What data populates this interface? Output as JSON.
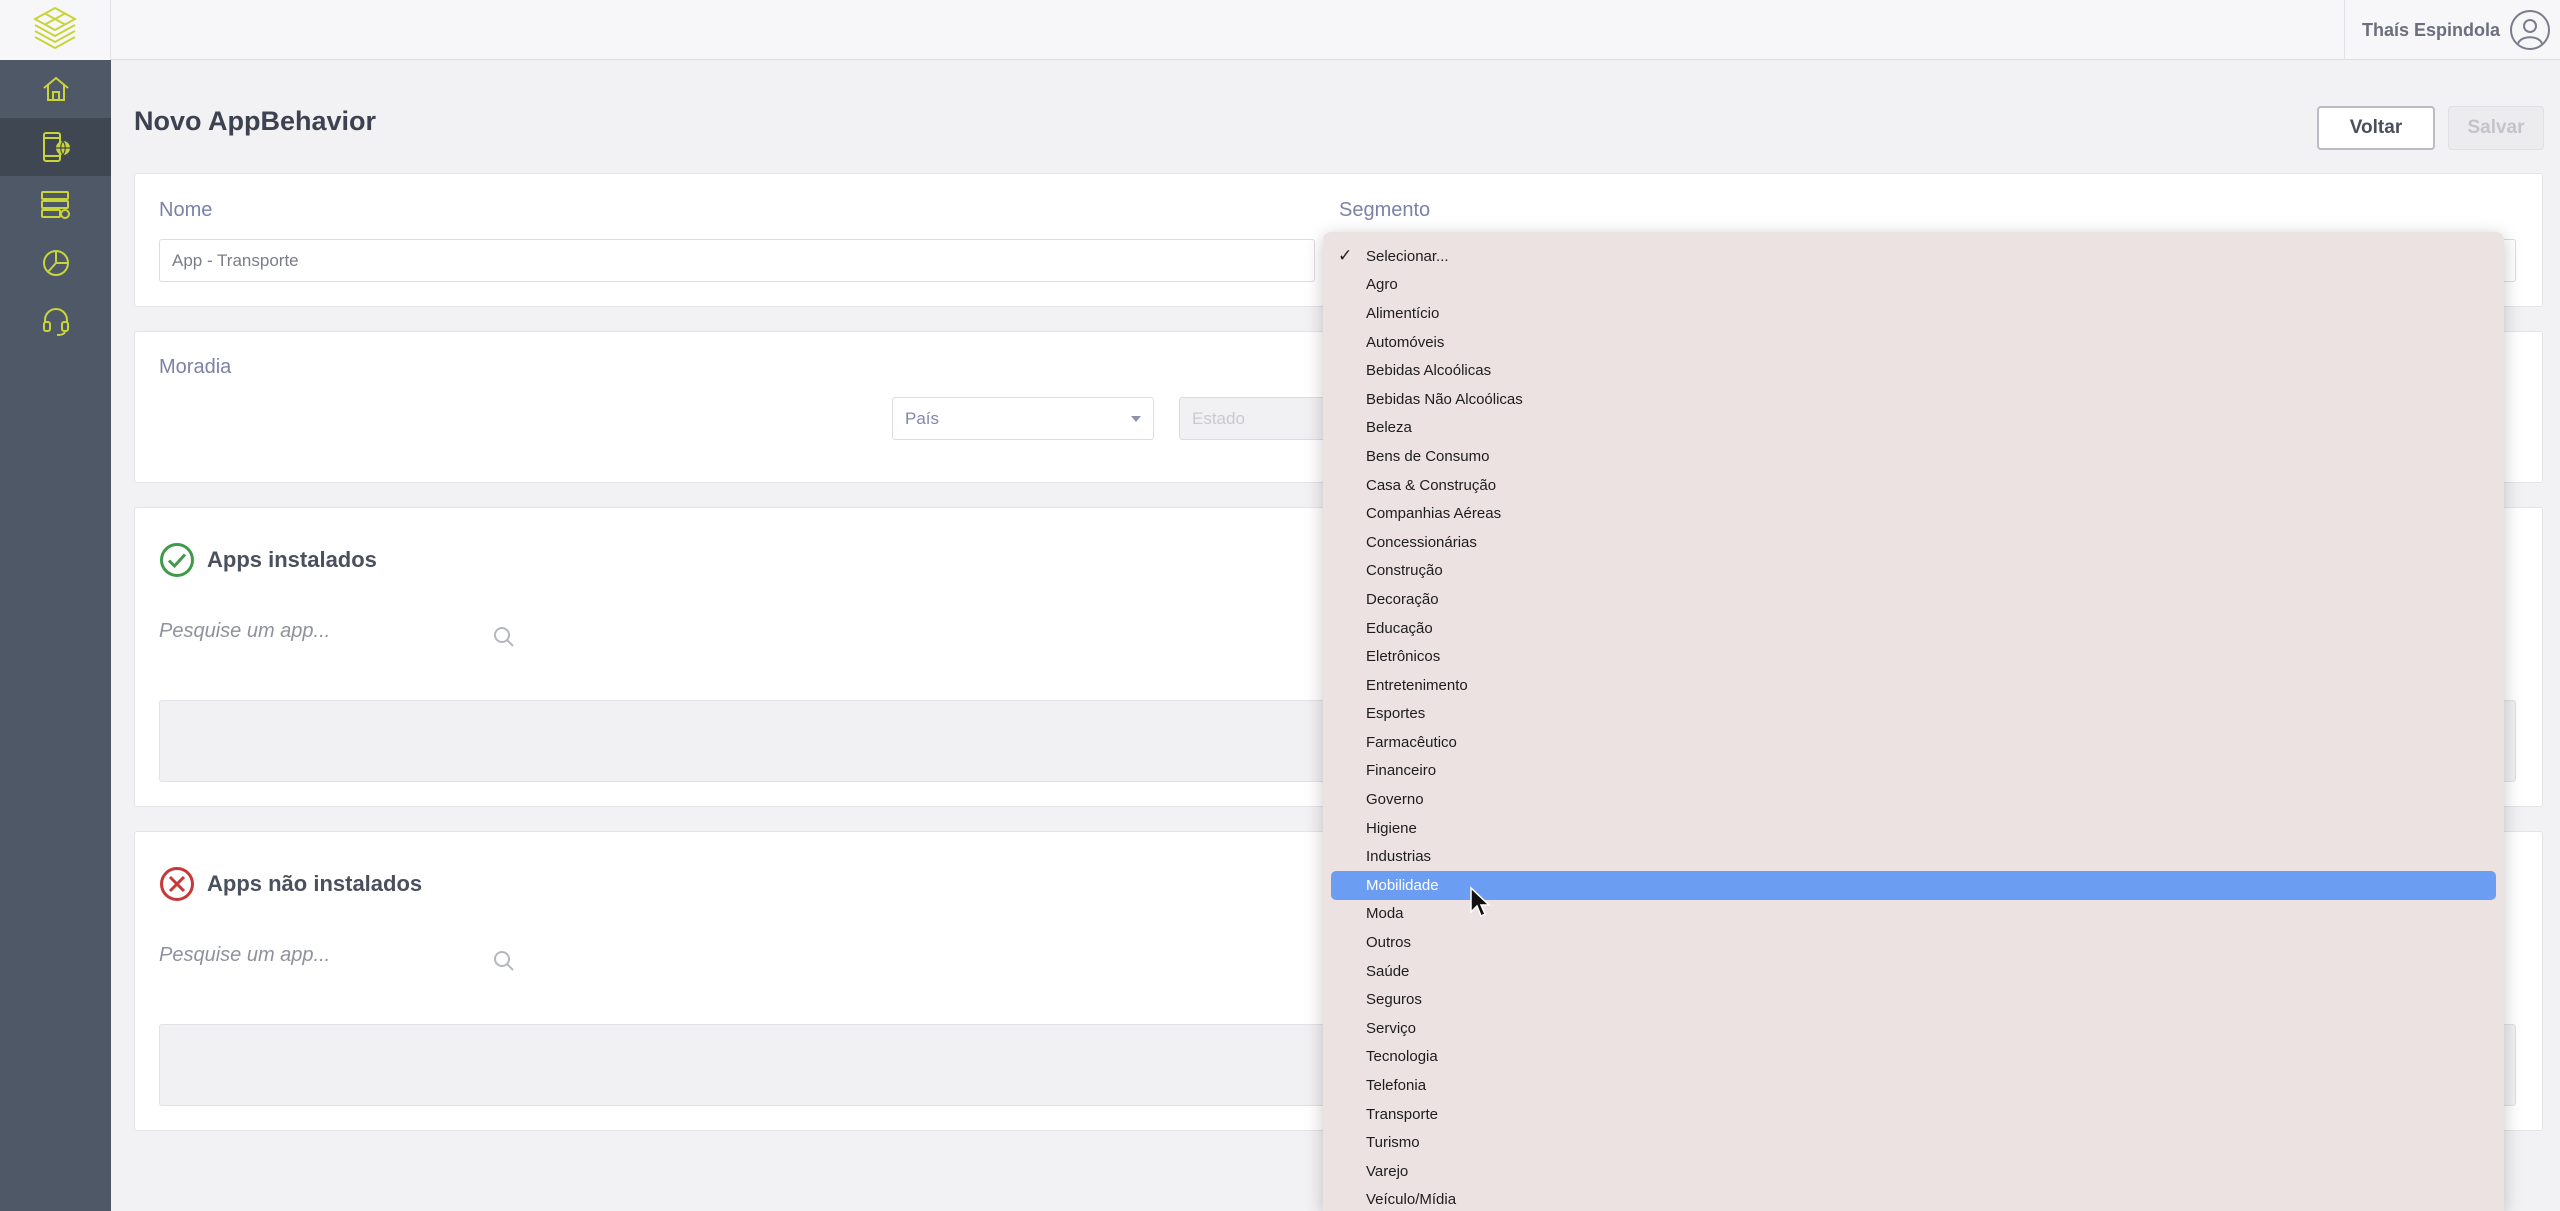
{
  "header": {
    "user_name": "Thaís Espindola"
  },
  "page": {
    "title": "Novo AppBehavior"
  },
  "toolbar": {
    "back_label": "Voltar",
    "save_label": "Salvar"
  },
  "form": {
    "nome": {
      "label": "Nome",
      "value": "App - Transporte"
    },
    "segmento": {
      "label": "Segmento"
    },
    "moradia": {
      "label": "Moradia",
      "pais_placeholder": "País",
      "estado_placeholder": "Estado"
    }
  },
  "installed": {
    "title": "Apps instalados",
    "search_placeholder": "Pesquise um app..."
  },
  "not_installed": {
    "title": "Apps não instalados",
    "search_placeholder": "Pesquise um app..."
  },
  "segment_options": [
    "Selecionar...",
    "Agro",
    "Alimentício",
    "Automóveis",
    "Bebidas Alcoólicas",
    "Bebidas Não Alcoólicas",
    "Beleza",
    "Bens de Consumo",
    "Casa & Construção",
    "Companhias Aéreas",
    "Concessionárias",
    "Construção",
    "Decoração",
    "Educação",
    "Eletrônicos",
    "Entretenimento",
    "Esportes",
    "Farmacêutico",
    "Financeiro",
    "Governo",
    "Higiene",
    "Industrias",
    "Mobilidade",
    "Moda",
    "Outros",
    "Saúde",
    "Seguros",
    "Serviço",
    "Tecnologia",
    "Telefonia",
    "Transporte",
    "Turismo",
    "Varejo",
    "Veículo/Mídia"
  ],
  "segment_checked": "Selecionar...",
  "segment_highlighted": "Mobilidade",
  "colors": {
    "sidebar": "#4f5866",
    "accent_green": "#c8d43a",
    "success": "#3f9a4a",
    "danger": "#c73838",
    "highlight": "#6b9ef3"
  },
  "icons": {
    "logo": "layered-diamond-logo",
    "nav": [
      "home-icon",
      "mobile-globe-icon",
      "server-stack-icon",
      "pie-chart-icon",
      "headset-icon"
    ],
    "installed": "check-circle-icon",
    "not_installed": "x-circle-icon",
    "search": "search-icon"
  }
}
